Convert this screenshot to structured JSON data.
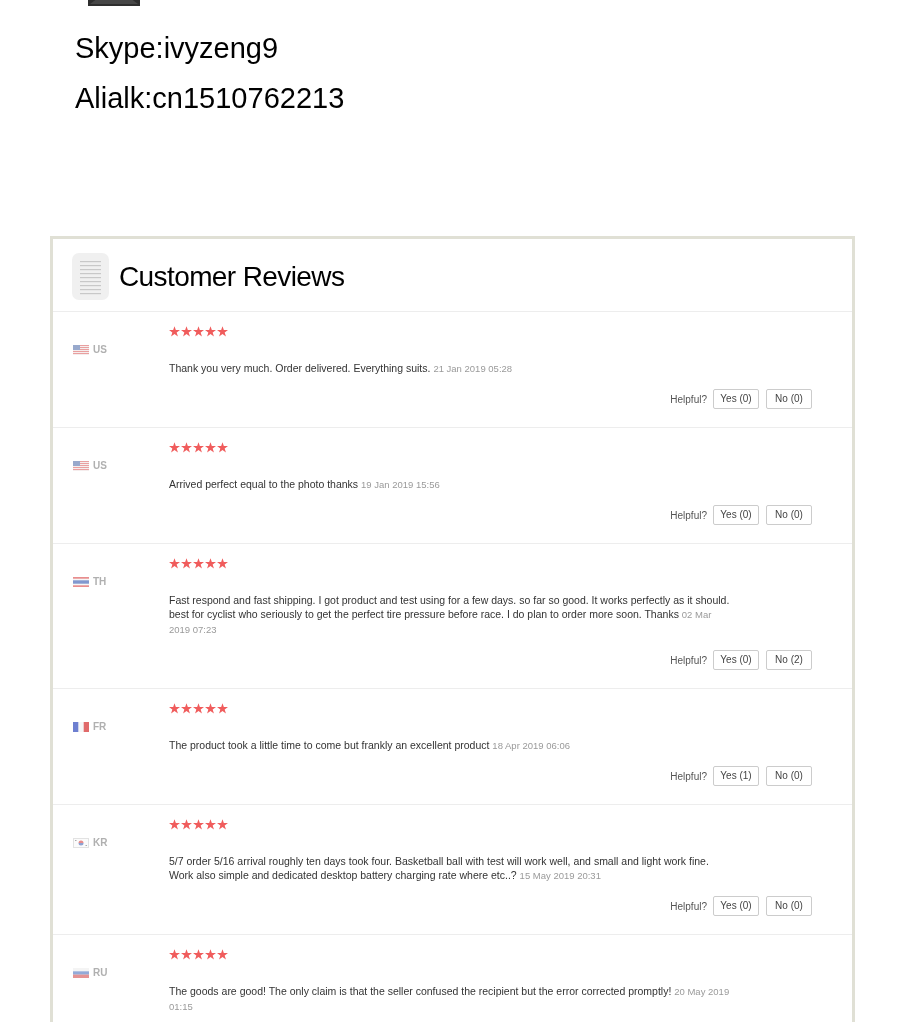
{
  "contact": {
    "lines": [
      "Skype:ivyzeng9",
      "Alialk:cn1510762213"
    ]
  },
  "reviews": {
    "title": "Customer Reviews",
    "items": [
      {
        "flag": {
          "kind": "us"
        },
        "country": "US",
        "stars": 5,
        "text": "Thank you very much. Order delivered. Everything suits.",
        "date": "21 Jan 2019 05:28",
        "helpful": {
          "label": "Helpful?",
          "buttons": [
            "Yes (0)",
            "No (0)"
          ]
        }
      },
      {
        "flag": {
          "kind": "us"
        },
        "country": "US",
        "stars": 5,
        "text": "Arrived perfect equal to the photo thanks",
        "date": "19 Jan 2019 15:56",
        "helpful": {
          "label": "Helpful?",
          "buttons": [
            "Yes (0)",
            "No (0)"
          ]
        }
      },
      {
        "flag": {
          "kind": "th"
        },
        "country": "TH",
        "stars": 5,
        "text": "Fast respond and fast shipping. I got product and test using for a few days. so far so good. It works perfectly as it should. best for cyclist who seriously to get the perfect tire pressure before race. I do plan to order more soon. Thanks",
        "date": "02 Mar 2019 07:23",
        "helpful": {
          "label": "Helpful?",
          "buttons": [
            "Yes (0)",
            "No (2)"
          ]
        }
      },
      {
        "flag": {
          "kind": "fr"
        },
        "country": "FR",
        "stars": 5,
        "text": "The product took a little time to come but frankly an excellent product",
        "date": "18 Apr 2019 06:06",
        "helpful": {
          "label": "Helpful?",
          "buttons": [
            "Yes (1)",
            "No (0)"
          ]
        }
      },
      {
        "flag": {
          "kind": "kr"
        },
        "country": "KR",
        "stars": 5,
        "text": "5/7 order 5/16 arrival roughly ten days took four. Basketball ball with test will work well, and small and light work fine. Work also simple and dedicated desktop battery charging rate where etc..?",
        "date": "15 May 2019 20:31",
        "helpful": {
          "label": "Helpful?",
          "buttons": [
            "Yes (0)",
            "No (0)"
          ]
        }
      },
      {
        "flag": {
          "kind": "ru"
        },
        "country": "RU",
        "stars": 5,
        "text": "The goods are good! The only claim is that the seller confused the recipient but the error corrected promptly!",
        "date": "20 May 2019 01:15"
      }
    ]
  }
}
